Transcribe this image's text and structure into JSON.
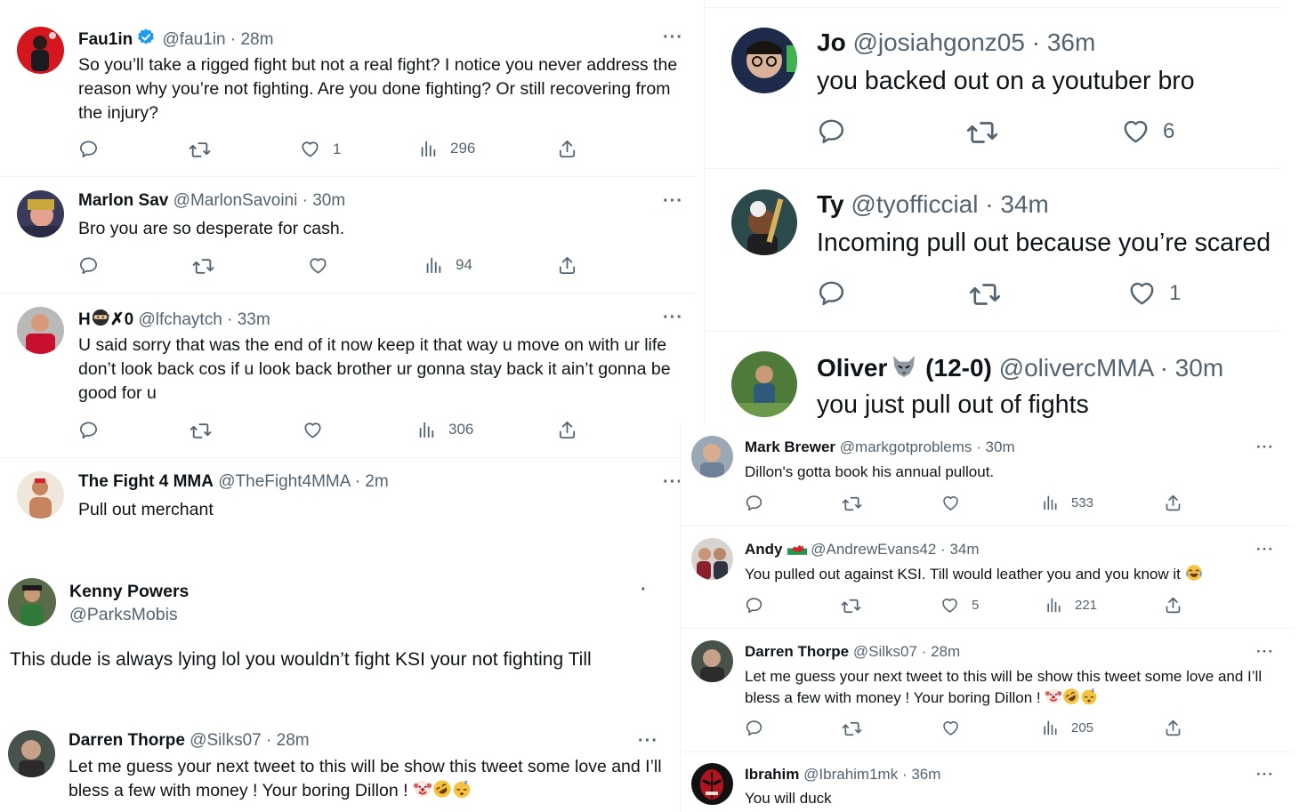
{
  "left_column": [
    {
      "name": "Fau1in",
      "handle": "@fau1in",
      "time": "28m",
      "verified": true,
      "text": "So you’ll take a rigged fight but not a real fight? I notice you never address the reason why you’re not fighting. Are you done fighting? Or still recovering from the injury?",
      "likes": "1",
      "views": "296"
    },
    {
      "name": "Marlon Sav",
      "handle": "@MarlonSavoini",
      "time": "30m",
      "text": "Bro you are so desperate for cash.",
      "likes": "",
      "views": "94"
    },
    {
      "name": "H",
      "name_suffix": "✗0",
      "handle": "@lfchaytch",
      "time": "33m",
      "text": "U said sorry that was the end of it now keep it that way u move on with ur life don’t look back cos if u look back brother ur gonna stay back it ain’t gonna be good for u",
      "likes": "",
      "views": "306"
    },
    {
      "name": "The Fight 4 MMA",
      "handle": "@TheFight4MMA",
      "time": "2m",
      "text": "Pull out merchant"
    },
    {
      "name": "Kenny Powers",
      "handle": "@ParksMobis",
      "text": "This dude is always lying lol you wouldn’t fight KSI your not fighting Till"
    },
    {
      "name": "Darren Thorpe",
      "handle": "@Silks07",
      "time": "28m",
      "text": "Let me guess your next tweet to this will be show this tweet some love and I’ll bless a few with money ! Your boring Dillon !"
    }
  ],
  "top_right": [
    {
      "name": "Jo",
      "handle": "@josiahgonz05",
      "time": "36m",
      "text": "you backed out on a youtuber bro",
      "likes": "6"
    },
    {
      "name": "Ty",
      "handle": "@tyofficcial",
      "time": "34m",
      "text": "Incoming pull out because you’re scared",
      "likes": "1"
    },
    {
      "name": "Oliver",
      "name_suffix": "(12-0)",
      "handle": "@olivercMMA",
      "time": "30m",
      "text": "you just pull out of fights"
    }
  ],
  "bottom_right": [
    {
      "name": "Mark Brewer",
      "handle": "@markgotproblems",
      "time": "30m",
      "text": "Dillon's gotta book his annual pullout.",
      "likes": "",
      "views": "533"
    },
    {
      "name": "Andy",
      "handle": "@AndrewEvans42",
      "time": "34m",
      "text": "You pulled out against KSI. Till would leather you and you know it",
      "likes": "5",
      "views": "221"
    },
    {
      "name": "Darren Thorpe",
      "handle": "@Silks07",
      "time": "28m",
      "text": "Let me guess your next tweet to this will be show this tweet some love and I’ll bless a few with money ! Your boring Dillon !",
      "likes": "",
      "views": "205"
    },
    {
      "name": "Ibrahim",
      "handle": "@Ibrahim1mk",
      "time": "36m",
      "text": "You will duck"
    }
  ],
  "ui": {
    "dot": "·",
    "more": "···",
    "more_single": "·"
  },
  "colors": {
    "text": "#0f1419",
    "muted": "#536471",
    "verified": "#1d9bf0",
    "separator": "#eff3f4"
  },
  "icons": [
    "reply-icon",
    "retweet-icon",
    "like-icon",
    "views-icon",
    "share-icon",
    "verified-badge-icon",
    "ninja-emoji",
    "wolf-emoji",
    "wales-flag-emoji",
    "joy-emoji",
    "clown-emoji",
    "rofl-emoji",
    "sleeping-emoji"
  ]
}
